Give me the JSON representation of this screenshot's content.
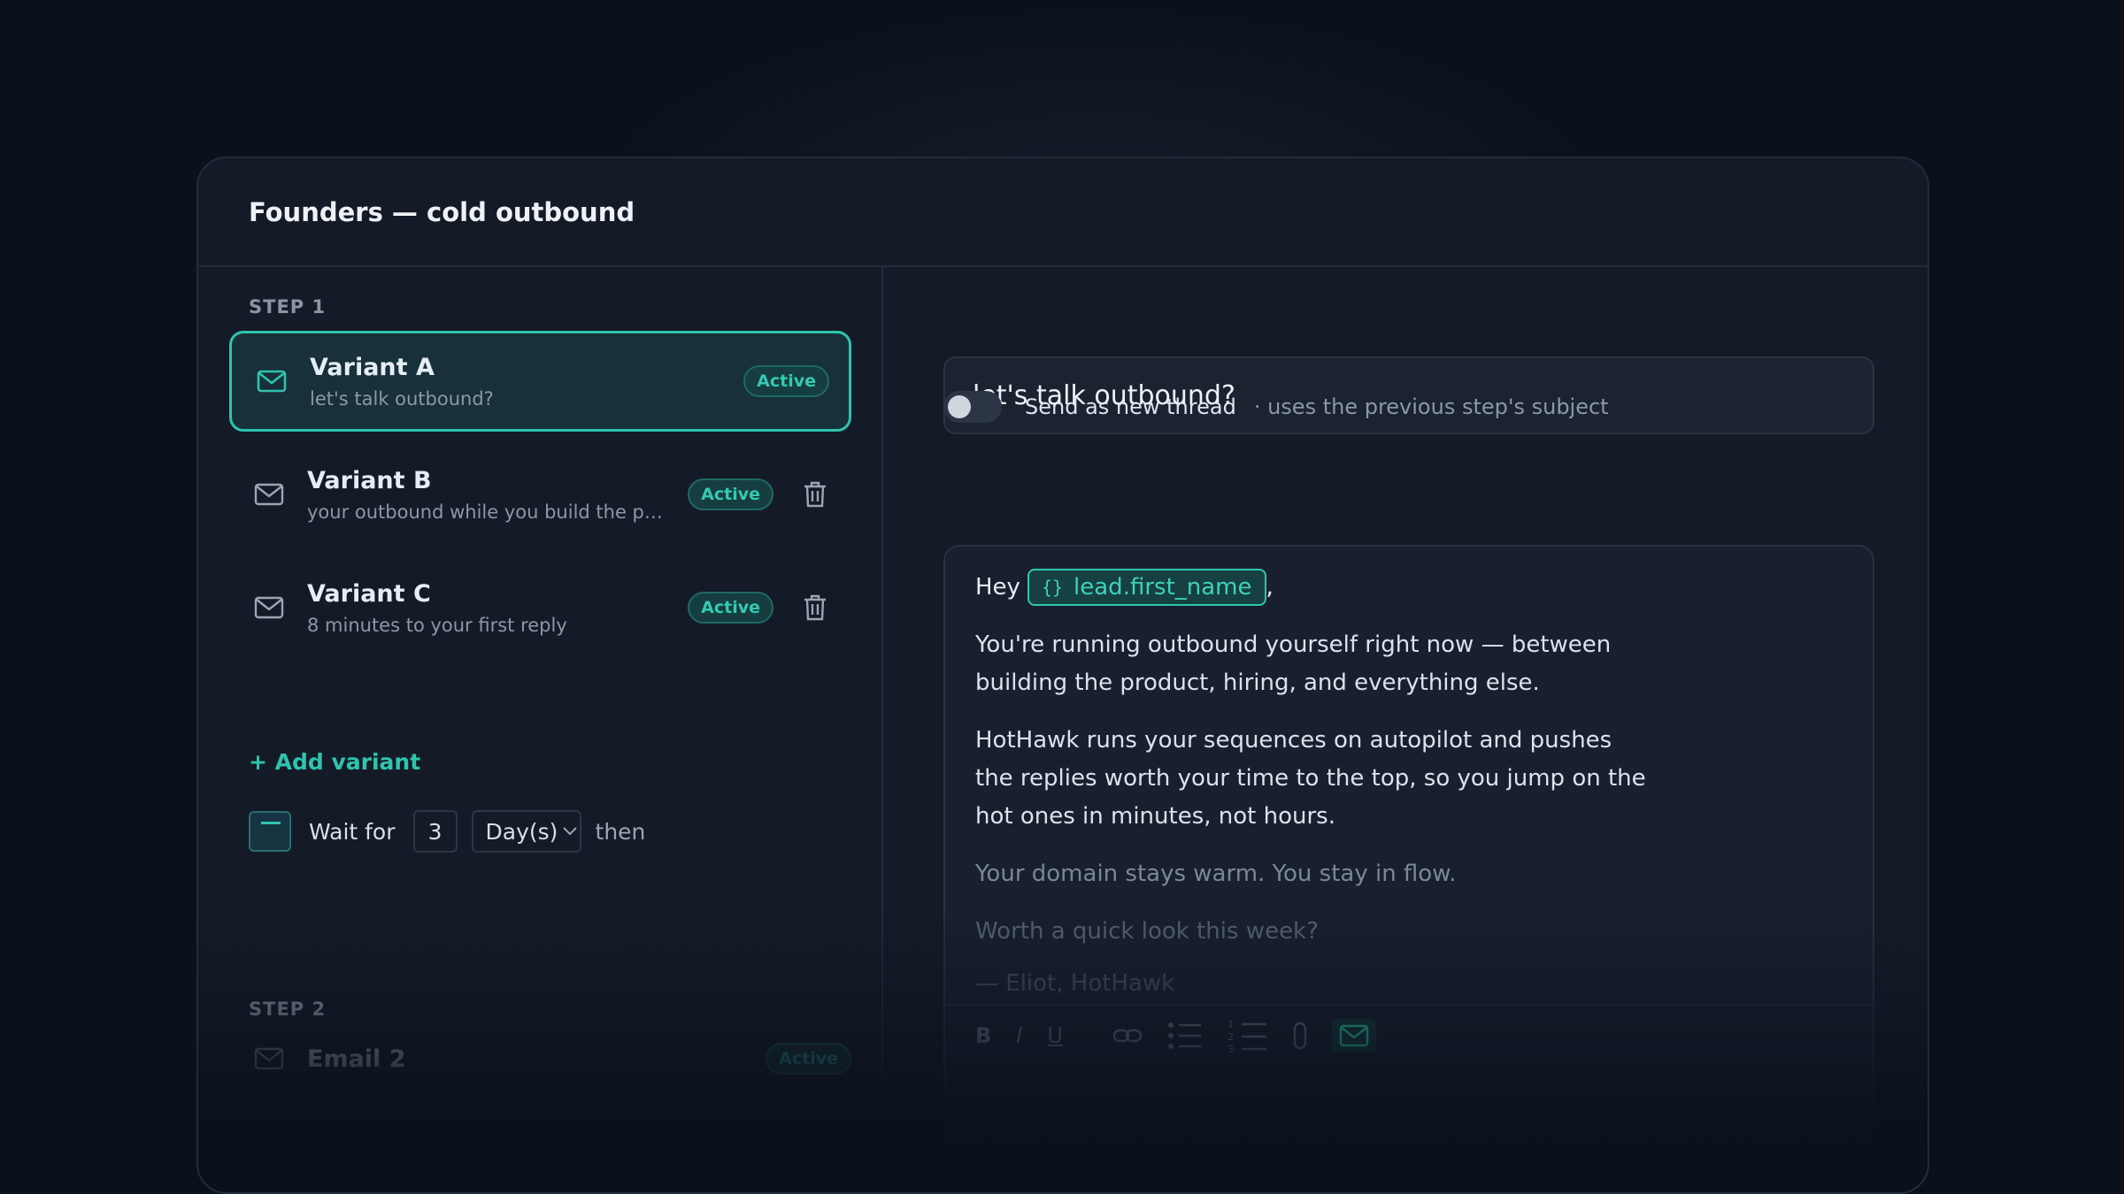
{
  "card": {
    "title": "Founders — cold outbound"
  },
  "steps": [
    {
      "label": "STEP 1",
      "variants": [
        {
          "name": "Variant A",
          "subject": "let's talk outbound?",
          "status": "Active",
          "selected": true
        },
        {
          "name": "Variant B",
          "subject": "your outbound while you build the pro...",
          "status": "Active",
          "selected": false
        },
        {
          "name": "Variant C",
          "subject": "8 minutes to your first reply",
          "status": "Active",
          "selected": false
        }
      ],
      "add_variant": "+ Add variant",
      "wait": {
        "prefix": "Wait for",
        "count": "3",
        "unit": "Day(s)",
        "suffix": "then"
      }
    },
    {
      "label": "STEP 2",
      "email": {
        "name": "Email 2",
        "status": "Active"
      }
    }
  ],
  "editor": {
    "subject": "let's talk outbound?",
    "new_thread": {
      "label": "Send as new thread",
      "hint": "· uses the previous step's subject"
    },
    "greeting": "Hey",
    "greeting_suffix": ",",
    "variable": "lead.first_name",
    "paragraphs": [
      "You're running outbound yourself right now — between building the product, hiring, and everything else.",
      "HotHawk runs your sequences on autopilot and pushes the replies worth your time to the top, so you jump on the hot ones in minutes, not hours.",
      "Your domain stays warm. You stay in flow.",
      "Worth a quick look this week?"
    ],
    "signature": "— Eliot, HotHawk",
    "toolbar": {
      "bold": "B",
      "italic": "I",
      "underline": "U"
    }
  },
  "colors": {
    "accent": "#2ec4ae",
    "background": "#0b111b",
    "card": "#141b27"
  }
}
